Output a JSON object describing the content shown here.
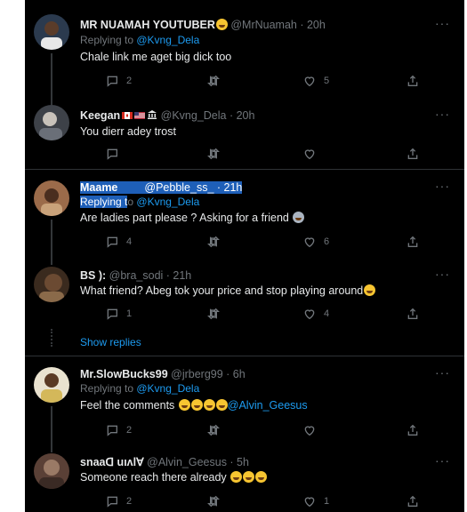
{
  "tweets": [
    {
      "name": "MR NUAMAH YOUTUBER",
      "handle": "@MrNuamah · 20h",
      "replying_prefix": "Replying to ",
      "replying_handle": "@Kvng_Dela",
      "text": "Chale link me aget big dick too",
      "replies": "2",
      "likes": "5",
      "avatar_color": "#6b7d93"
    },
    {
      "name": "Keegan",
      "handle": "@Kvng_Dela · 20h",
      "text": "You dierr adey trost",
      "avatar_color": "#4a4f57"
    },
    {
      "name": "Maame",
      "handle": "@Pebble_ss_ · 21h",
      "replying_prefix": "Replying t",
      "replying_prefix_rest": "o ",
      "replying_handle": "@Kvng_Dela",
      "text": "Are ladies part please ? Asking for a friend",
      "replies": "4",
      "likes": "6",
      "avatar_color": "#8a5a3c"
    },
    {
      "name": "BS ):",
      "handle": "@bra_sodi · 21h",
      "text": "What friend? Abeg tok your price and stop playing around",
      "replies": "1",
      "likes": "4",
      "avatar_color": "#6e4b2e"
    },
    {
      "name": "Mr.SlowBucks99",
      "handle": "@jrberg99 · 6h",
      "replying_prefix": "Replying to ",
      "replying_handle": "@Kvng_Dela",
      "text": "Feel the comments",
      "text_mention": "@Alvin_Geesus",
      "replies": "2",
      "avatar_color": "#d8c7a0"
    },
    {
      "name": "snaaᗡ uıʌlⱯ",
      "handle": "@Alvin_Geesus · 5h",
      "text": "Someone reach there already",
      "replies": "2",
      "likes": "1",
      "avatar_color": "#7a5a4a"
    }
  ],
  "show_replies": "Show replies",
  "more_label": "···"
}
